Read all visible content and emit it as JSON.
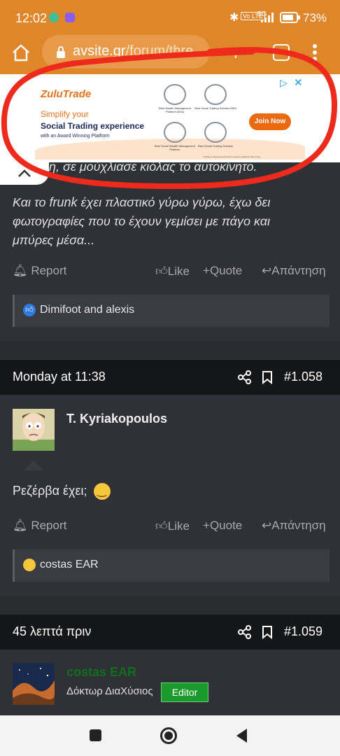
{
  "status_bar": {
    "time": "12:02",
    "network": "5G",
    "battery": "73%"
  },
  "browser": {
    "url_domain": "avsite.gr",
    "url_path": "/forum/thre"
  },
  "ad": {
    "brand": "ZuluTrade",
    "headline_line1": "Simplify your",
    "headline_line2": "Social Trading experience",
    "tagline": "with an Award Winning Platform",
    "cta": "Join Now",
    "awards": [
      "Best Wealth Management Platform Africa",
      "Best Social Trading Solution MEA",
      "Best Social Wealth Management Platform",
      "Best Social Trading Solution"
    ],
    "disclaimer": "Trading in financial instruments involves significant risk of loss"
  },
  "post1": {
    "truncated_line": "η, σε μούχλιασε κιόλας το αυτοκίνητο.",
    "text_lines": [
      "Και το frunk έχει πλαστικό γύρω γύρω, έχω δει",
      "φωτογραφίες που το έχουν γεμίσει με πάγο και",
      "μπύρες μέσα..."
    ],
    "actions": {
      "report": "Report",
      "like": "Like",
      "quote": "Quote",
      "reply": "Απάντηση"
    },
    "reactions": "Dimifoot and alexis"
  },
  "post2": {
    "date": "Monday at 11:38",
    "number": "#1.058",
    "author": "T. Kyriakopoulos",
    "text": "Ρεζέρβα έχει;",
    "actions": {
      "report": "Report",
      "like": "Like",
      "quote": "Quote",
      "reply": "Απάντηση"
    },
    "reactions": "costas EAR"
  },
  "post3": {
    "date": "45 λεπτά πριν",
    "number": "#1.059",
    "author": "costas EAR",
    "user_title": "Δόκτωρ ΔιαΧύσιος",
    "badge": "Editor"
  },
  "colors": {
    "status_bar": "#e0862a",
    "background": "#2f3136",
    "post_header": "#151618",
    "editor_badge": "#1a9a2a",
    "author_green": "#0e6f1b"
  }
}
